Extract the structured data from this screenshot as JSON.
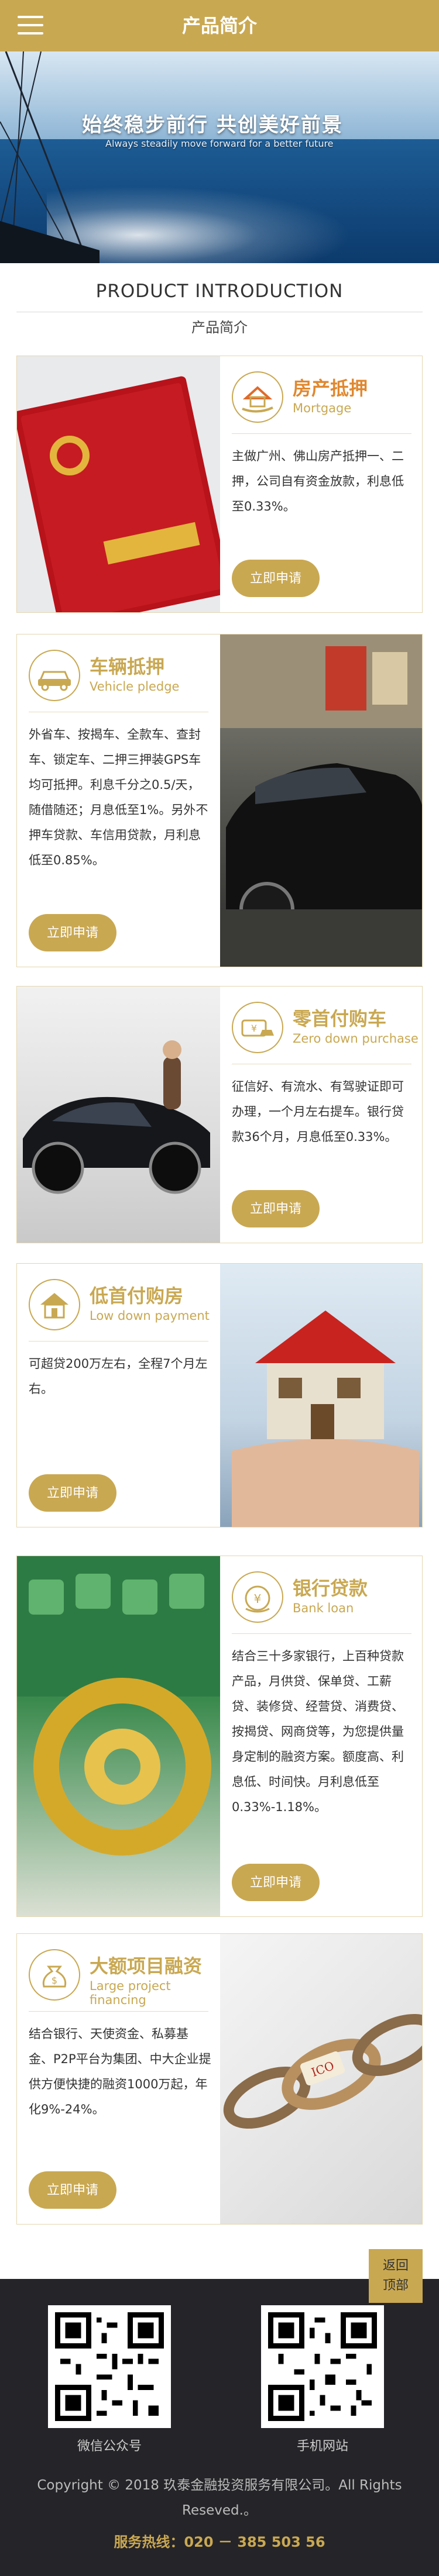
{
  "header": {
    "title": "产品简介",
    "menu_icon": "menu-icon"
  },
  "banner": {
    "title": "始终稳步前行  共创美好前景",
    "subtitle": "Always steadily move forward for a better future"
  },
  "section": {
    "title_en": "PRODUCT INTRODUCTION",
    "title_cn": "产品简介"
  },
  "products": [
    {
      "title": "房产抵押",
      "subtitle": "Mortgage",
      "icon": "house-hand-icon",
      "desc": "主做广州、佛山房产抵押一、二押，公司自有资金放款，利息低至0.33%。",
      "button": "立即申请"
    },
    {
      "title": "车辆抵押",
      "subtitle": "Vehicle pledge",
      "icon": "car-icon",
      "desc": "外省车、按揭车、全款车、查封车、锁定车、二押三押装GPS车均可抵押。利息千分之0.5/天，随借随还；月息低至1%。另外不押车贷款、车信用贷款，月利息低至0.85%。",
      "button": "立即申请"
    },
    {
      "title": "零首付购车",
      "subtitle": "Zero down purchase",
      "icon": "money-car-icon",
      "desc": "征信好、有流水、有驾驶证即可办理，一个月左右提车。银行贷款36个月，月息低至0.33%。",
      "button": "立即申请"
    },
    {
      "title": "低首付购房",
      "subtitle": "Low down payment",
      "icon": "house-icon",
      "desc": "可超贷200万左右，全程7个月左右。",
      "button": "立即申请"
    },
    {
      "title": "银行贷款",
      "subtitle": "Bank loan",
      "icon": "yen-bag-icon",
      "desc": "结合三十多家银行，上百种贷款产品，月供贷、保单贷、工薪贷、装修贷、经营贷、消费贷、按揭贷、网商贷等，为您提供量身定制的融资方案。额度高、利息低、时间快。月利息低至0.33%-1.18%。",
      "button": "立即申请"
    },
    {
      "title": "大额项目融资",
      "subtitle": "Large project financing",
      "icon": "money-bag-icon",
      "desc": "结合银行、天使资金、私募基金、P2P平台为集团、中大企业提供方便快捷的融资1000万起，年化9%-24%。",
      "button": "立即申请"
    }
  ],
  "back_to_top": {
    "line1": "返回",
    "line2": "顶部"
  },
  "footer": {
    "qr1_label": "微信公众号",
    "qr2_label": "手机网站",
    "copyright": "Copyright © 2018 玖泰金融投资服务有限公司。All Rights Reseved.。",
    "hotline": "服务热线：020 － 385 503 56"
  },
  "colors": {
    "accent": "#c9a852",
    "footer_bg": "#252428"
  }
}
